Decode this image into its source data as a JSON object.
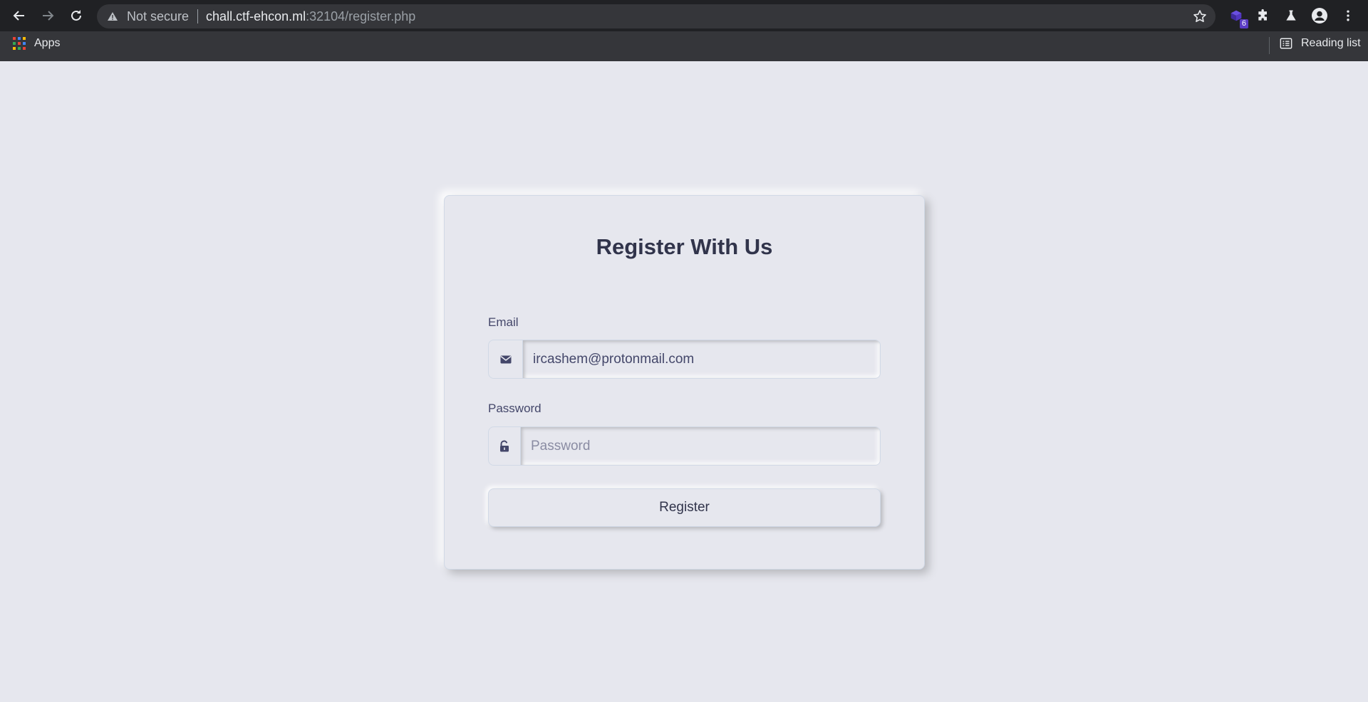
{
  "browser": {
    "omnibox": {
      "security_label": "Not secure",
      "url_host": "chall.ctf-ehcon.ml",
      "url_rest": ":32104/register.php"
    },
    "extension_badge": "6",
    "bookmarks": {
      "apps_label": "Apps",
      "reading_list_label": "Reading list"
    },
    "icons": [
      "back-icon",
      "forward-icon",
      "reload-icon",
      "warning-icon",
      "star-icon",
      "extension-icon",
      "puzzle-icon",
      "labs-icon",
      "profile-icon",
      "menu-icon",
      "apps-grid-icon",
      "reading-list-icon"
    ]
  },
  "page": {
    "title": "Register With Us",
    "email": {
      "label": "Email",
      "value": "ircashem@protonmail.com",
      "icon": "envelope-icon"
    },
    "password": {
      "label": "Password",
      "placeholder": "Password",
      "icon": "unlock-icon"
    },
    "submit_label": "Register"
  },
  "colors": {
    "background": "#e6e7ee",
    "text_dark": "#31344b",
    "text": "#44476a",
    "chrome_dark": "#202124",
    "chrome_bar": "#35363a"
  }
}
